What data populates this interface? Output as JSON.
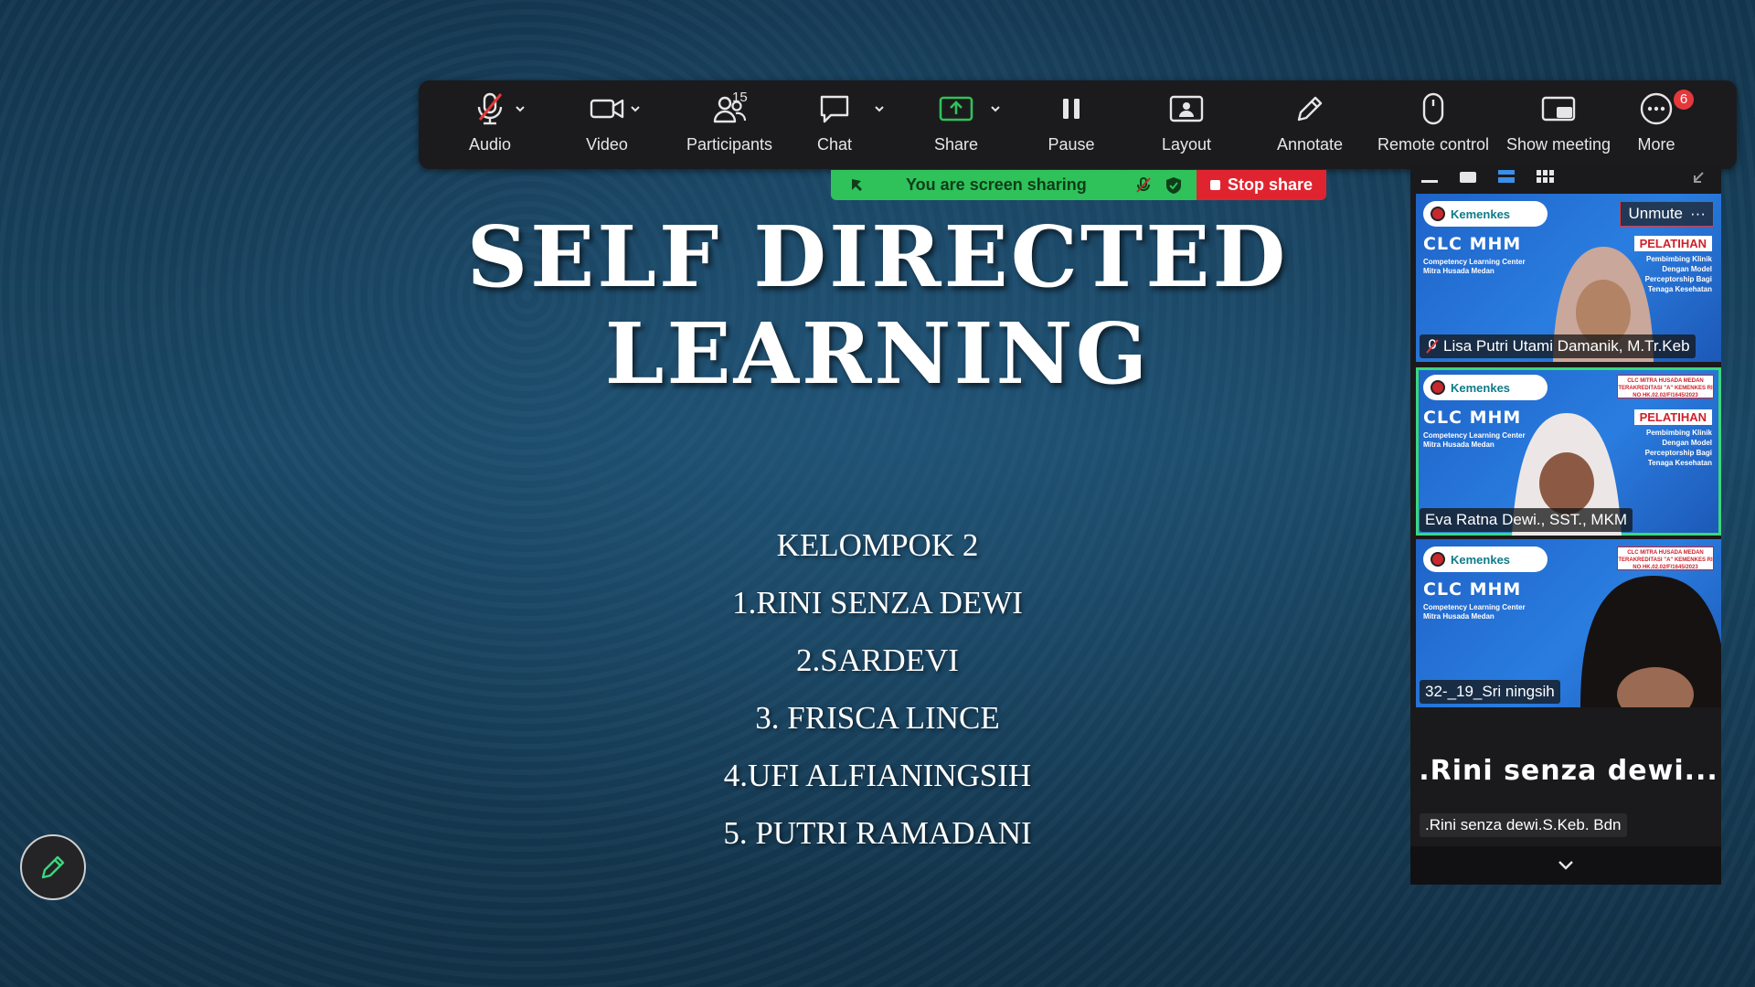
{
  "slide": {
    "title_line1": "SELF DIRECTED",
    "title_line2": "LEARNING",
    "list": [
      "KELOMPOK 2",
      "1.RINI SENZA DEWI",
      "2.SARDEVI",
      "3. FRISCA LINCE",
      "4.UFI ALFIANINGSIH",
      "5. PUTRI RAMADANI"
    ]
  },
  "toolbar": {
    "audio": "Audio",
    "video": "Video",
    "participants": "Participants",
    "participants_count": "15",
    "chat": "Chat",
    "share": "Share",
    "pause": "Pause",
    "layout": "Layout",
    "annotate": "Annotate",
    "remote_control": "Remote control",
    "show_meeting": "Show meeting",
    "more": "More",
    "more_badge": "6"
  },
  "share_banner": {
    "text": "You are screen sharing",
    "stop": "Stop share"
  },
  "tiles": {
    "kemenkes": "Kemenkes",
    "clc": "CLC MHM",
    "clc_sub1": "Competency Learning Center",
    "clc_sub2": "Mitra Husada Medan",
    "pelatihan": "PELATIHAN",
    "pel_desc": "Pembimbing Klinik Dengan Model Perceptorship Bagi Tenaga Kesehatan",
    "badge1": "CLC MITRA HUSADA MEDAN",
    "badge2": "TERAKREDITASI \"A\" KEMENKES RI",
    "badge3": "NO HK.02.02/F/1645/2023",
    "t1_name": "Lisa Putri Utami Damanik, M.Tr.Keb",
    "t1_unmute": "Unmute",
    "t2_name": "Eva Ratna Dewi., SST., MKM",
    "t3_name": "32-_19_Sri ningsih",
    "t4_big": ".Rini senza dewi...",
    "t4_name": ".Rini senza dewi.S.Keb. Bdn"
  },
  "colors": {
    "toolbar_bg": "#1b1b1d",
    "share_green": "#2fc25a",
    "stop_red": "#e0242f",
    "mute_red": "#e5383b",
    "active_speaker": "#3ad87d",
    "tile_blue": "#2a7de0"
  },
  "icons": [
    "microphone-muted-icon",
    "video-camera-icon",
    "participants-icon",
    "chat-bubble-icon",
    "share-screen-icon",
    "pause-icon",
    "layout-icon",
    "pencil-icon",
    "mouse-icon",
    "show-meeting-icon",
    "more-icon",
    "chevron-down-icon"
  ]
}
